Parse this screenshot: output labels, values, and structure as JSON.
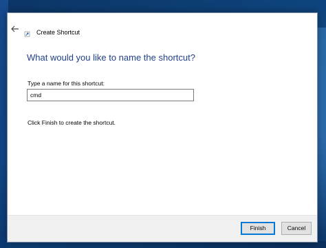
{
  "window": {
    "title": "Create Shortcut",
    "back_icon": "arrow-left-icon",
    "app_icon": "shortcut-icon"
  },
  "main": {
    "heading": "What would you like to name the shortcut?",
    "field_label": "Type a name for this shortcut:",
    "field_value": "cmd",
    "instruction": "Click Finish to create the shortcut."
  },
  "footer": {
    "finish_label": "Finish",
    "cancel_label": "Cancel"
  },
  "colors": {
    "heading": "#1e3f8a",
    "default_button_border": "#0078d7",
    "wallpaper": "#0f4a86"
  }
}
